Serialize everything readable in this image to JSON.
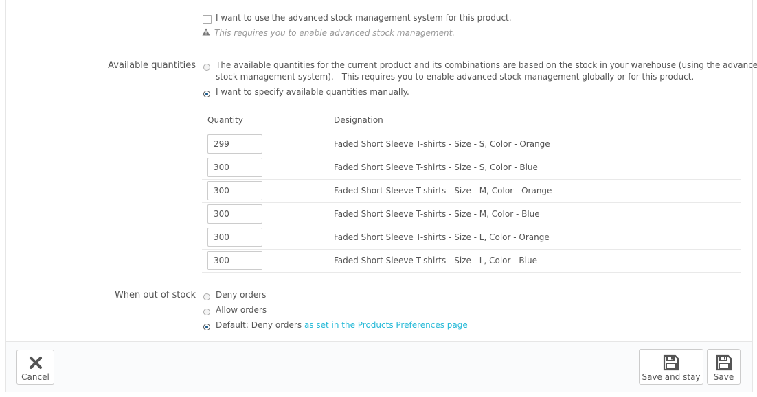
{
  "advanced_stock": {
    "checkbox_label": "I want to use the advanced stock management system for this product.",
    "help_text": "This requires you to enable advanced stock management."
  },
  "available_quantities": {
    "label": "Available quantities",
    "option_warehouse_line1": "The available quantities for the current product and its combinations are based on the stock in your warehouse (using the advanced",
    "option_warehouse_line2": "stock management system).  - This requires you to enable advanced stock management globally or for this product.",
    "option_manual": "I want to specify available quantities manually.",
    "selected": "manual"
  },
  "table": {
    "headers": {
      "quantity": "Quantity",
      "designation": "Designation"
    },
    "rows": [
      {
        "quantity": "299",
        "designation": "Faded Short Sleeve T-shirts - Size - S, Color - Orange"
      },
      {
        "quantity": "300",
        "designation": "Faded Short Sleeve T-shirts - Size - S, Color - Blue"
      },
      {
        "quantity": "300",
        "designation": "Faded Short Sleeve T-shirts - Size - M, Color - Orange"
      },
      {
        "quantity": "300",
        "designation": "Faded Short Sleeve T-shirts - Size - M, Color - Blue"
      },
      {
        "quantity": "300",
        "designation": "Faded Short Sleeve T-shirts - Size - L, Color - Orange"
      },
      {
        "quantity": "300",
        "designation": "Faded Short Sleeve T-shirts - Size - L, Color - Blue"
      }
    ]
  },
  "out_of_stock": {
    "label": "When out of stock",
    "deny": "Deny orders",
    "allow": "Allow orders",
    "default_prefix": "Default: Deny orders",
    "default_link": "as set in the Products Preferences page",
    "selected": "default"
  },
  "footer": {
    "cancel": "Cancel",
    "save_and_stay": "Save and stay",
    "save": "Save"
  },
  "colors": {
    "link": "#25b9d7",
    "radio_selected": "#1f5c8b",
    "table_header_border": "#b9d6ea"
  },
  "icons": {
    "warning": "warning-icon",
    "cancel": "close-icon",
    "save": "floppy-disk-icon"
  }
}
